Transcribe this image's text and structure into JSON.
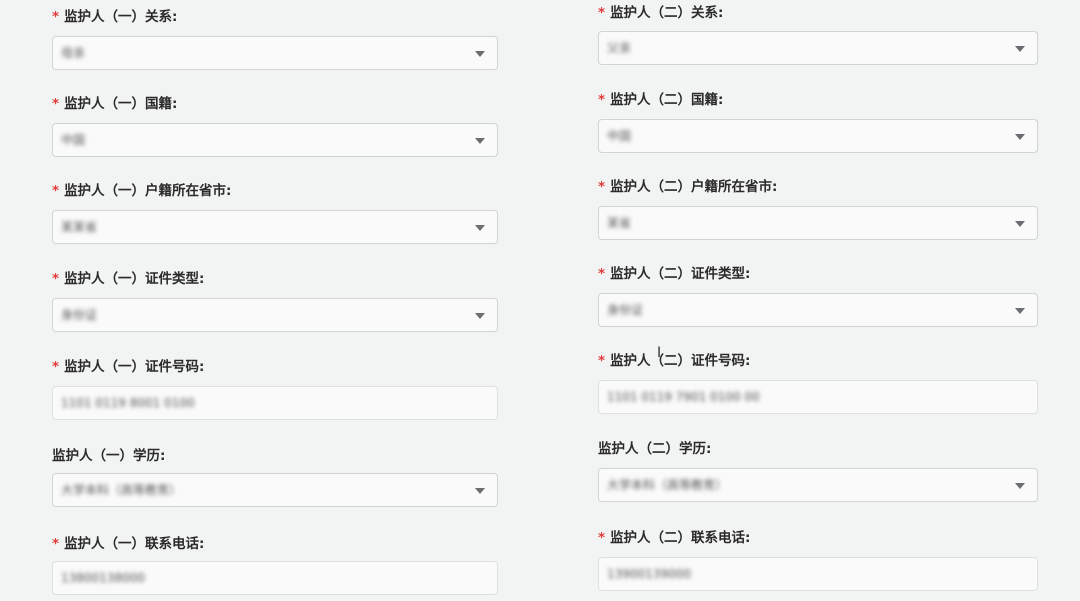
{
  "required_mark": "*",
  "guardian1": {
    "relation": {
      "label": "监护人（一）关系:",
      "value": "母亲"
    },
    "nationality": {
      "label": "监护人（一）国籍:",
      "value": "中国"
    },
    "province": {
      "label": "监护人（一）户籍所在省市:",
      "value": "某某省"
    },
    "id_type": {
      "label": "监护人（一）证件类型:",
      "value": "身份证"
    },
    "id_number": {
      "label": "监护人（一）证件号码:",
      "value": "1101 0119 8001 0100"
    },
    "education": {
      "label": "监护人（一）学历:",
      "value": "大学本科（高等教育）"
    },
    "phone": {
      "label": "监护人（一）联系电话:",
      "value": "13800138000"
    }
  },
  "guardian2": {
    "relation": {
      "label": "监护人（二）关系:",
      "value": "父亲"
    },
    "nationality": {
      "label": "监护人（二）国籍:",
      "value": "中国"
    },
    "province": {
      "label": "监护人（二）户籍所在省市:",
      "value": "某省"
    },
    "id_type": {
      "label": "监护人（二）证件类型:",
      "value": "身份证"
    },
    "id_number": {
      "label": "监护人（二）证件号码:",
      "value": "1101 0119 7901 0100 00"
    },
    "education": {
      "label": "监护人（二）学历:",
      "value": "大学本科（高等教育）"
    },
    "phone": {
      "label": "监护人（二）联系电话:",
      "value": "13900139000"
    }
  },
  "cursor_glyph": "I"
}
